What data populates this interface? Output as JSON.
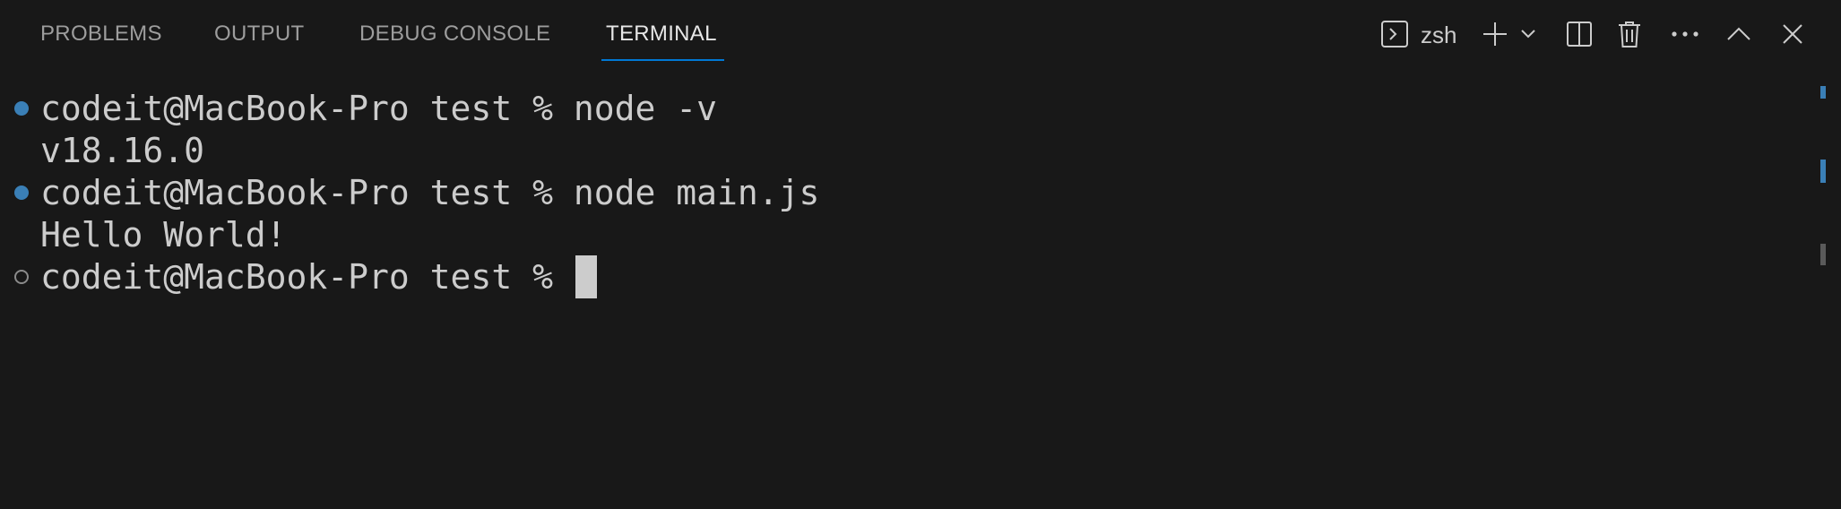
{
  "tabs": [
    {
      "label": "PROBLEMS",
      "active": false
    },
    {
      "label": "OUTPUT",
      "active": false
    },
    {
      "label": "DEBUG CONSOLE",
      "active": false
    },
    {
      "label": "TERMINAL",
      "active": true
    }
  ],
  "toolbar": {
    "shell_label": "zsh",
    "icons": [
      "terminal-icon",
      "plus-icon",
      "chevron-down-icon",
      "split-icon",
      "trash-icon",
      "ellipsis-icon",
      "chevron-up-icon",
      "close-icon"
    ]
  },
  "terminal": {
    "lines": [
      {
        "text": "codeit@MacBook-Pro test % node -v",
        "decoration": "success"
      },
      {
        "text": "v18.16.0",
        "decoration": "none"
      },
      {
        "text": "codeit@MacBook-Pro test % node main.js",
        "decoration": "success"
      },
      {
        "text": "Hello World!",
        "decoration": "none"
      },
      {
        "text": "codeit@MacBook-Pro test % ",
        "decoration": "pending"
      }
    ]
  },
  "colors": {
    "background": "#181818",
    "accent": "#0078d4",
    "success_dot": "#3a7fb6",
    "text": "#cccccc"
  }
}
